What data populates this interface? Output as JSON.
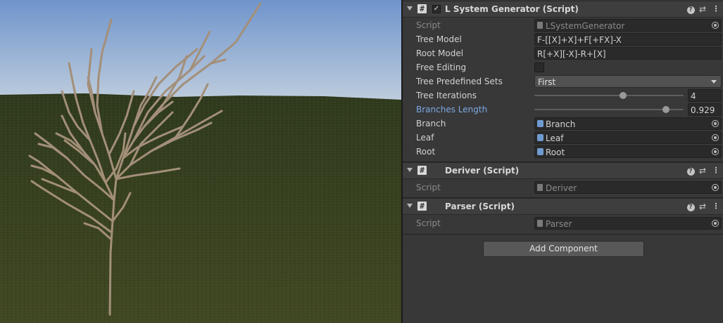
{
  "scene": {
    "sky_top_color": "#6f95cc",
    "sky_bottom_color": "#c2cfde",
    "ground_color": "#3a4222",
    "branch_color": "#a38f79"
  },
  "lsystem": {
    "title": "L System Generator (Script)",
    "enabled": true,
    "fields": {
      "script": {
        "label": "Script",
        "value": "LSystemGenerator"
      },
      "tree_model": {
        "label": "Tree Model",
        "value": "F-[[X]+X]+F[+FX]-X"
      },
      "root_model": {
        "label": "Root Model",
        "value": "R[+X][-X]-R+[X]"
      },
      "free_editing": {
        "label": "Free Editing",
        "checked": false
      },
      "tree_predefined_sets": {
        "label": "Tree Predefined Sets",
        "value": "First"
      },
      "tree_iterations": {
        "label": "Tree Iterations",
        "value": "4",
        "slider_fraction": 0.6
      },
      "branches_length": {
        "label": "Branches Length",
        "value": "0.929",
        "slider_fraction": 0.9
      },
      "branch": {
        "label": "Branch",
        "value": "Branch"
      },
      "leaf": {
        "label": "Leaf",
        "value": "Leaf"
      },
      "root": {
        "label": "Root",
        "value": "Root"
      }
    }
  },
  "deriver": {
    "title": "Deriver (Script)",
    "script_label": "Script",
    "script_value": "Deriver"
  },
  "parser": {
    "title": "Parser (Script)",
    "script_label": "Script",
    "script_value": "Parser"
  },
  "add_component_label": "Add Component",
  "colors": {
    "highlight_label": "#7ea9e6",
    "object_icon": "#6f9bd1"
  },
  "icons": {
    "fold": "triangle-down",
    "script": "hash",
    "help": "question",
    "presets": "sliders",
    "menu": "vertical-dots",
    "object_picker": "target-circle"
  }
}
